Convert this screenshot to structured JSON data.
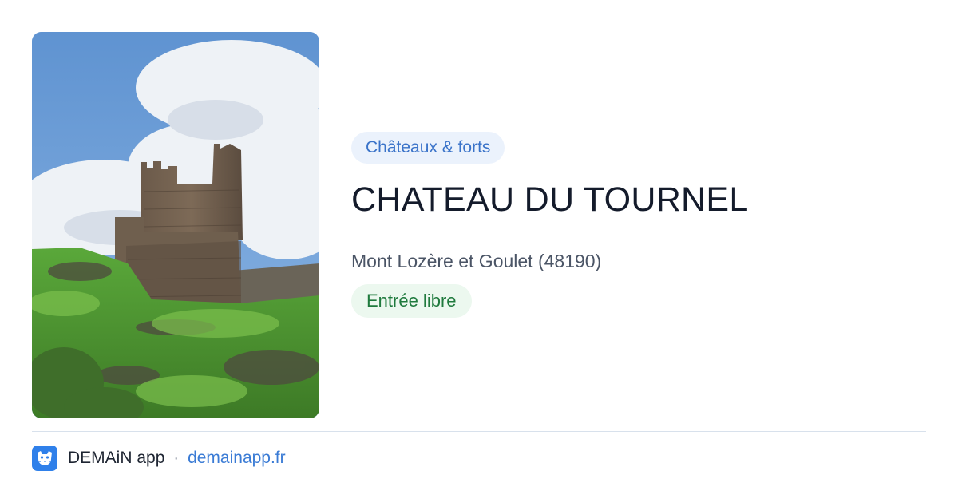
{
  "category": "Châteaux & forts",
  "title": "CHATEAU DU TOURNEL",
  "location": "Mont Lozère et Goulet (48190)",
  "access": "Entrée libre",
  "footer": {
    "app_name": "DEMAiN app",
    "separator": "·",
    "domain": "demainapp.fr"
  },
  "icons": {
    "logo": "demain-app-logo-icon"
  },
  "colors": {
    "category_bg": "#ebf2fc",
    "category_text": "#3a73c9",
    "access_bg": "#ecf8ef",
    "access_text": "#1f7a3d",
    "link": "#3a7bd5",
    "logo_bg": "#2f80ea"
  }
}
